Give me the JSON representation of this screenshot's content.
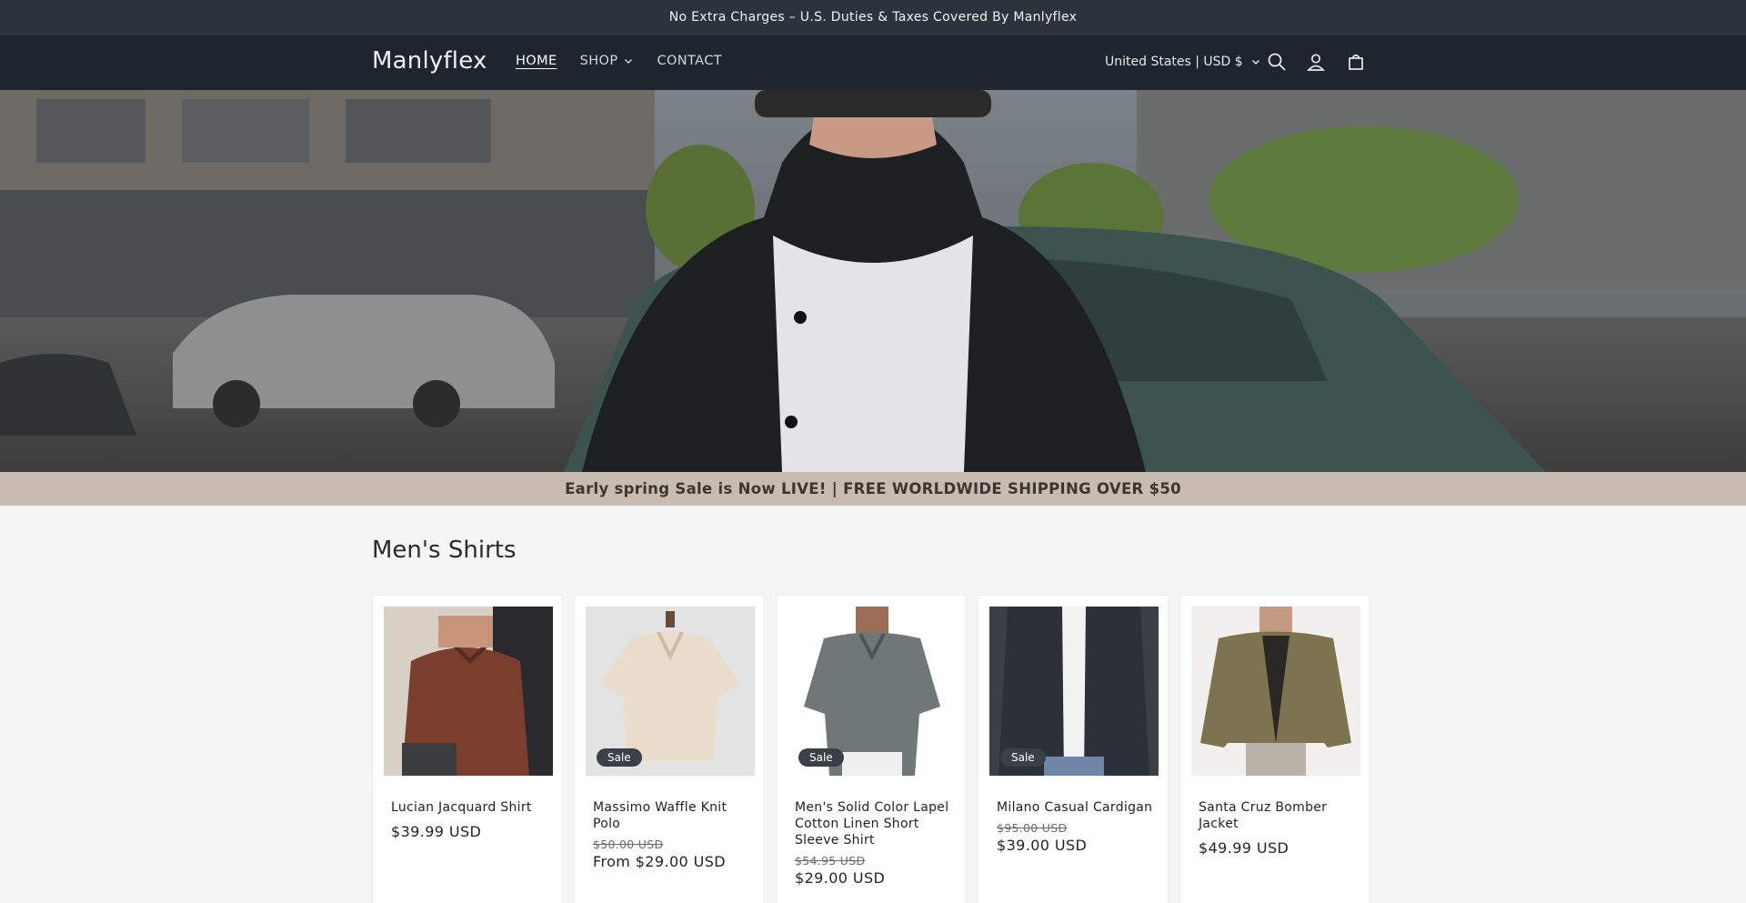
{
  "announcement": "No Extra Charges – U.S. Duties & Taxes Covered By Manlyflex",
  "header": {
    "logo": "Manlyflex",
    "nav": [
      {
        "label": "HOME"
      },
      {
        "label": "SHOP"
      },
      {
        "label": "CONTACT"
      }
    ],
    "country": "United States | USD $",
    "icons": [
      "search-icon",
      "account-icon",
      "cart-icon"
    ]
  },
  "promo": "Early spring Sale is Now LIVE! | FREE WORLDWIDE SHIPPING OVER $50",
  "section": {
    "title": "Men's Shirts",
    "products": [
      {
        "title": "Lucian Jacquard Shirt",
        "price": "$39.99 USD",
        "old_price": "",
        "badge": ""
      },
      {
        "title": "Massimo Waffle Knit Polo",
        "price": "From $29.00 USD",
        "old_price": "$50.00 USD",
        "badge": "Sale"
      },
      {
        "title": "Men's Solid Color Lapel Cotton Linen Short Sleeve Shirt",
        "price": "$29.00 USD",
        "old_price": "$54.95 USD",
        "badge": "Sale"
      },
      {
        "title": "Milano Casual Cardigan",
        "price": "$39.00 USD",
        "old_price": "$95.00 USD",
        "badge": "Sale"
      },
      {
        "title": "Santa Cruz Bomber Jacket",
        "price": "$49.99 USD",
        "old_price": "",
        "badge": ""
      }
    ]
  },
  "colors": {
    "announce_bg": "#2d333d",
    "header_bg": "#1f252e",
    "promo_bg": "#c8bcb2",
    "badge_bg": "#3a4048"
  }
}
